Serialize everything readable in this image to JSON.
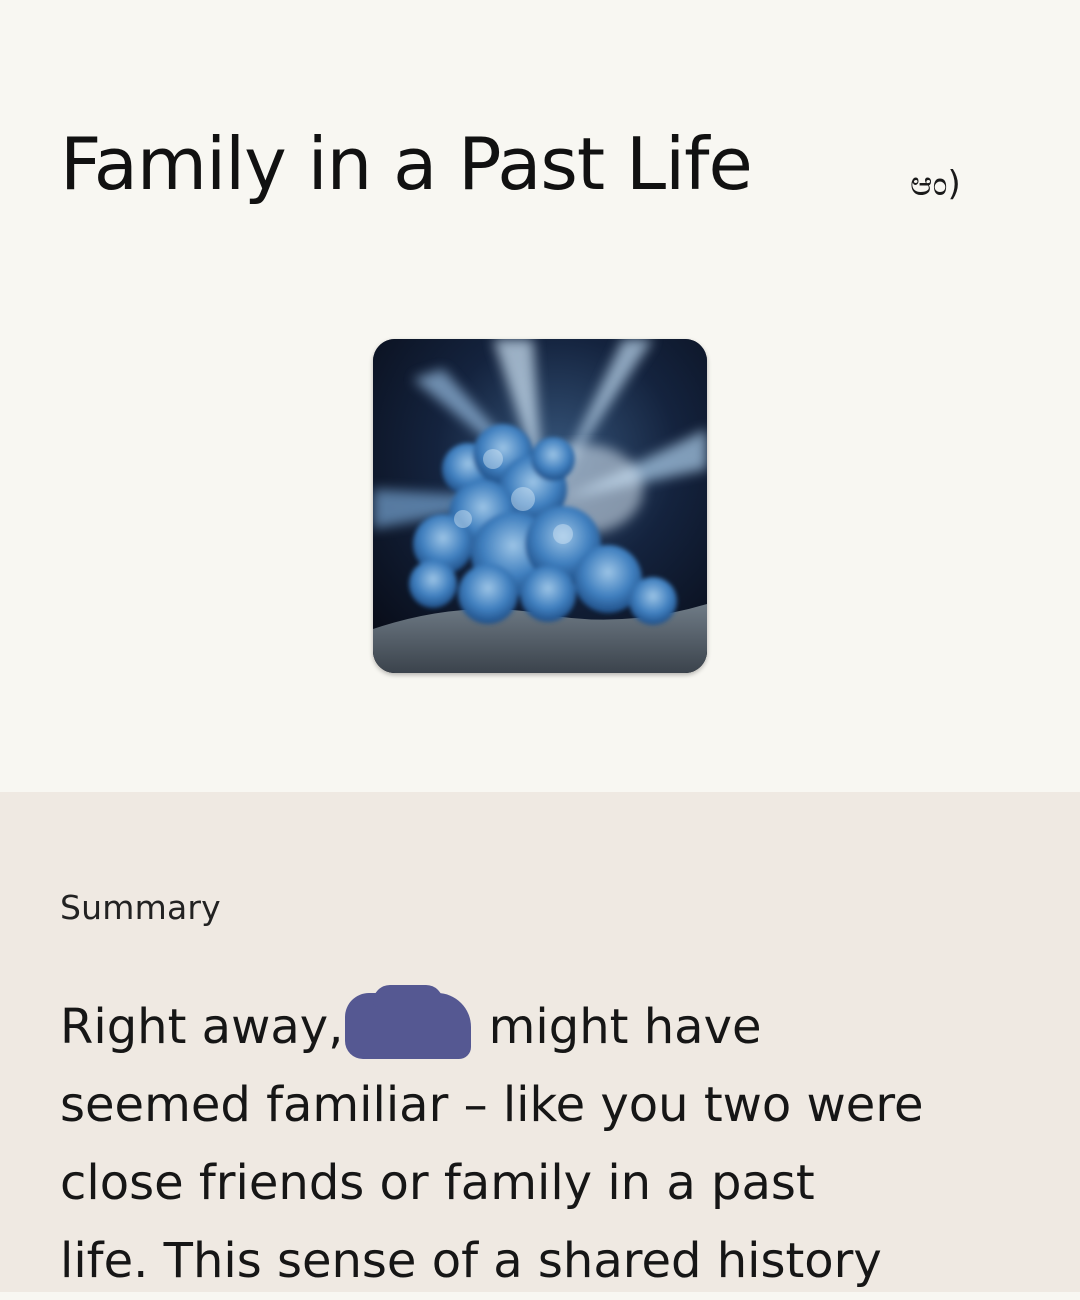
{
  "header": {
    "title": "Family in a Past Life",
    "symbol": "ಆಂ)"
  },
  "art": {
    "description_icon": "blue-smoke-cloud-image"
  },
  "summary": {
    "label": "Summary",
    "lines": [
      {
        "before": "Right away,",
        "after": " might have"
      },
      "seemed familiar – like you two were",
      "close friends or family in a past",
      "life. This sense of a shared history"
    ]
  },
  "colors": {
    "top_background": "#f8f7f2",
    "summary_background": "#efe9e2",
    "redaction": "#555892"
  }
}
